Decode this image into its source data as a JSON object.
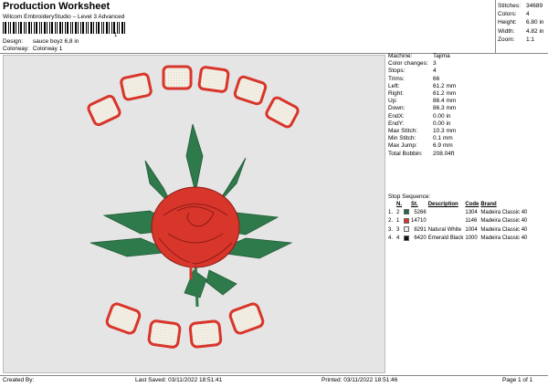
{
  "header": {
    "title": "Production Worksheet",
    "subtitle": "Wilcom EmbroideryStudio – Level 3 Advanced",
    "barcode_number": "1",
    "design_label": "Design:",
    "design_value": "sauce boyz 6,8 in",
    "colorway_label": "Colorway:",
    "colorway_value": "Colorway 1"
  },
  "stats": [
    {
      "label": "Stitches:",
      "value": "34689"
    },
    {
      "label": "Colors:",
      "value": "4"
    },
    {
      "label": "Height:",
      "value": "6.80 in"
    },
    {
      "label": "Width:",
      "value": "4.82 in"
    },
    {
      "label": "Zoom:",
      "value": "1:1"
    }
  ],
  "details": [
    {
      "label": "Machine:",
      "value": "Tajima"
    },
    {
      "label": "Color changes:",
      "value": "3"
    },
    {
      "label": "Stops:",
      "value": "4"
    },
    {
      "label": "Trims:",
      "value": "66"
    },
    {
      "label": "Left:",
      "value": "61.2 mm"
    },
    {
      "label": "Right:",
      "value": "61.2 mm"
    },
    {
      "label": "Up:",
      "value": "86.4 mm"
    },
    {
      "label": "Down:",
      "value": "86.3 mm"
    },
    {
      "label": "EndX:",
      "value": "0.00 in"
    },
    {
      "label": "EndY:",
      "value": "0.00 in"
    },
    {
      "label": "Max Stitch:",
      "value": "10.3 mm"
    },
    {
      "label": "Min Stitch:",
      "value": "0.1 mm"
    },
    {
      "label": "Max Jump:",
      "value": "6.9 mm"
    },
    {
      "label": "Total Bobbin:",
      "value": "208.04ft"
    }
  ],
  "stop_sequence": {
    "title": "Stop Sequence:",
    "headers": {
      "n": "N.",
      "st": "St.",
      "description": "Description",
      "code": "Code",
      "brand": "Brand"
    },
    "rows": [
      {
        "idx": "1.",
        "n": "2",
        "color": "#1f6b44",
        "st": "5266",
        "description": "",
        "code": "1304",
        "brand": "Madeira Classic 40"
      },
      {
        "idx": "2.",
        "n": "1",
        "color": "#d8352b",
        "st": "14710",
        "description": "",
        "code": "1146",
        "brand": "Madeira Classic 40"
      },
      {
        "idx": "3.",
        "n": "3",
        "color": "#f2f0e6",
        "st": "8291",
        "description": "Natural White",
        "code": "1004",
        "brand": "Madeira Classic 40"
      },
      {
        "idx": "4.",
        "n": "4",
        "color": "#111111",
        "st": "6420",
        "description": "Emerald Black",
        "code": "1000",
        "brand": "Madeira Classic 40"
      }
    ]
  },
  "footer": {
    "created_by": "Created By:",
    "last_saved": "Last Saved: 03/11/2022 18:51:41",
    "printed": "Printed: 03/11/2022 18:51:46",
    "page": "Page 1 of 1"
  },
  "design_colors": {
    "green": "#2f7a4a",
    "red": "#d8352b",
    "white": "#f3efe4",
    "dark": "#222222"
  }
}
